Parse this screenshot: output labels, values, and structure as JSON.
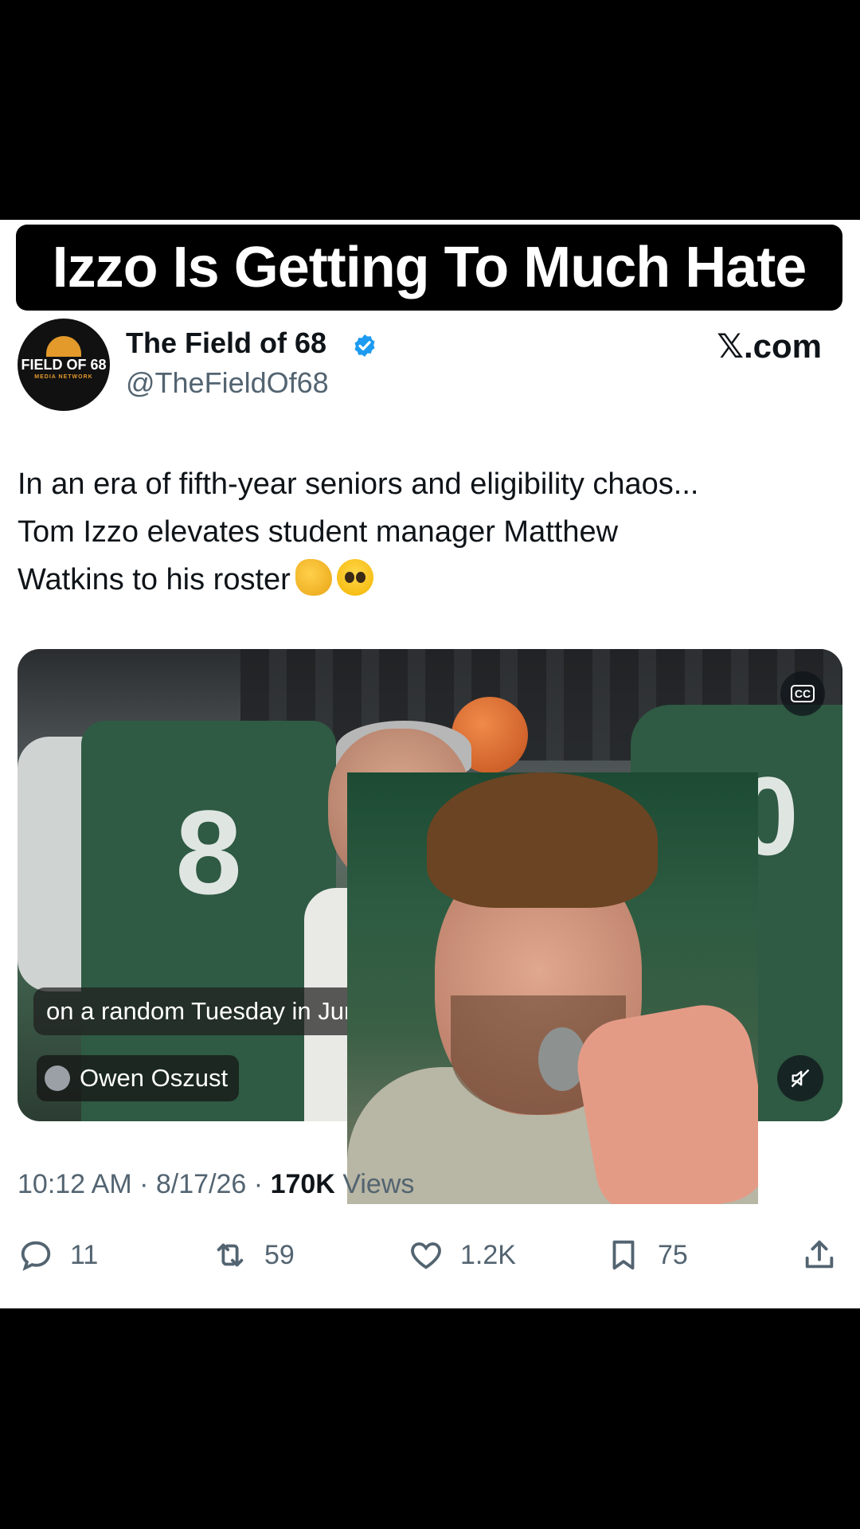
{
  "headline": "Izzo Is Getting To Much Hate",
  "account": {
    "display_name": "The Field of 68",
    "handle": "@TheFieldOf68",
    "avatar_text": "FIELD OF 68",
    "avatar_subtext": "MEDIA NETWORK",
    "verified": true
  },
  "source_label": "𝕏.com",
  "tweet": {
    "line1": "In an era of fifth-year seniors and eligibility chaos...",
    "line2": "Tom Izzo elevates student manager Matthew",
    "line3": "Watkins to his roster",
    "emojis": [
      "clapping-hands",
      "pleading-face"
    ]
  },
  "video": {
    "caption": "on a random Tuesday in June",
    "attribution_name": "Owen Oszust",
    "cc_label": "CC",
    "jersey_left": "8",
    "jersey_right": "40"
  },
  "meta": {
    "time": "10:12 AM",
    "date": "8/17/26",
    "views_count": "170K",
    "views_label": "Views",
    "separator": "·"
  },
  "actions": {
    "replies": "11",
    "reposts": "59",
    "likes": "1.2K",
    "bookmarks": "75"
  },
  "colors": {
    "verified": "#1d9bf0",
    "secondary_text": "#536471",
    "primary_text": "#0f1419"
  }
}
